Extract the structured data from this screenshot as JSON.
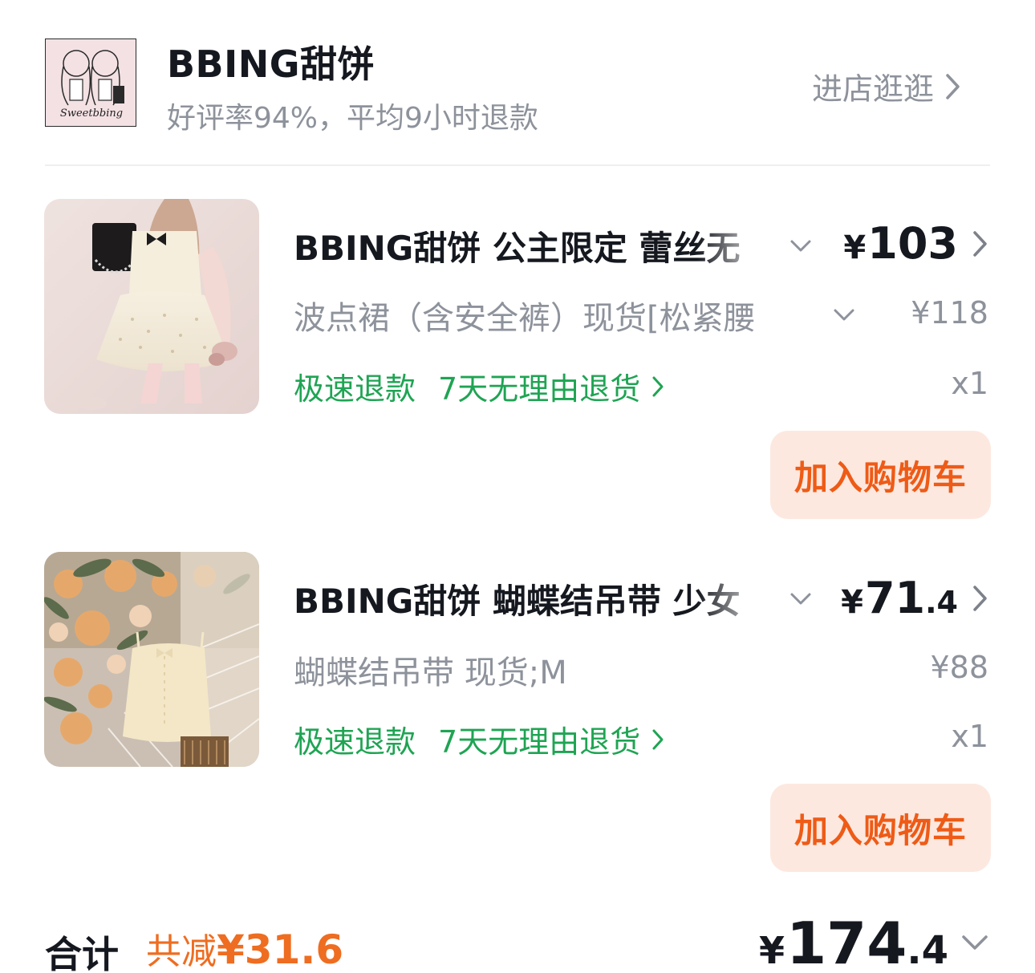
{
  "shop": {
    "name": "BBING甜饼",
    "subtitle": "好评率94%，平均9小时退款",
    "visit_label": "进店逛逛",
    "logo_text": "Sweetbbing"
  },
  "products": [
    {
      "title": "BBING甜饼 公主限定 蕾丝无",
      "price_currency": "¥",
      "price_int": "103",
      "price_dec": "",
      "sku": "波点裙（含安全裤）现货[松紧腰",
      "original_price": "¥118",
      "service_fast_refund": "极速退款",
      "service_return": "7天无理由退货",
      "quantity": "x1",
      "add_cart_label": "加入购物车"
    },
    {
      "title": "BBING甜饼 蝴蝶结吊带 少女",
      "price_currency": "¥",
      "price_int": "71",
      "price_dec": ".4",
      "sku": "蝴蝶结吊带 现货;M",
      "original_price": "¥88",
      "service_fast_refund": "极速退款",
      "service_return": "7天无理由退货",
      "quantity": "x1",
      "add_cart_label": "加入购物车"
    }
  ],
  "summary": {
    "total_label": "合计",
    "discount_label": "共减",
    "discount_amount": "¥31.6",
    "total_currency": "¥",
    "total_int": "174",
    "total_dec": ".4"
  },
  "colors": {
    "accent_orange": "#ee5b16",
    "service_green": "#1fa453",
    "muted_text": "#8d929b",
    "cart_button_bg": "#fde8e0"
  }
}
